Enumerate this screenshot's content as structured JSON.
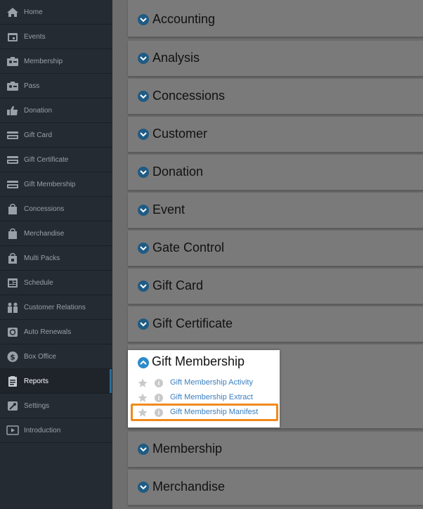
{
  "sidebar": {
    "items": [
      {
        "label": "Home",
        "icon": "home-icon"
      },
      {
        "label": "Events",
        "icon": "calendar-icon"
      },
      {
        "label": "Membership",
        "icon": "membership-card-icon"
      },
      {
        "label": "Pass",
        "icon": "pass-card-icon"
      },
      {
        "label": "Donation",
        "icon": "thumbs-up-icon"
      },
      {
        "label": "Gift Card",
        "icon": "credit-card-icon"
      },
      {
        "label": "Gift Certificate",
        "icon": "certificate-card-icon"
      },
      {
        "label": "Gift Membership",
        "icon": "gift-membership-card-icon"
      },
      {
        "label": "Concessions",
        "icon": "shopping-bag-icon"
      },
      {
        "label": "Merchandise",
        "icon": "bag-icon"
      },
      {
        "label": "Multi Packs",
        "icon": "multi-pack-bag-icon"
      },
      {
        "label": "Schedule",
        "icon": "schedule-icon"
      },
      {
        "label": "Customer Relations",
        "icon": "people-icon"
      },
      {
        "label": "Auto Renewals",
        "icon": "refresh-icon"
      },
      {
        "label": "Box Office",
        "icon": "dollar-icon"
      },
      {
        "label": "Reports",
        "icon": "clipboard-icon",
        "active": true
      },
      {
        "label": "Settings",
        "icon": "wrench-icon"
      },
      {
        "label": "Introduction",
        "icon": "play-icon"
      }
    ]
  },
  "sections": {
    "accounting": "Accounting",
    "analysis": "Analysis",
    "concessions": "Concessions",
    "customer": "Customer",
    "donation": "Donation",
    "event": "Event",
    "gate_control": "Gate Control",
    "gift_card": "Gift Card",
    "gift_certificate": "Gift Certificate",
    "membership": "Membership",
    "merchandise": "Merchandise"
  },
  "expanded": {
    "title": "Gift Membership",
    "reports": [
      "Gift Membership Activity",
      "Gift Membership Extract",
      "Gift Membership Manifest"
    ]
  },
  "colors": {
    "sidebar_bg": "#252b33",
    "active_indicator": "#2f6d97",
    "highlight": "#f08a1c",
    "link": "#3b7fbf",
    "chevron": "#1f5b84"
  }
}
